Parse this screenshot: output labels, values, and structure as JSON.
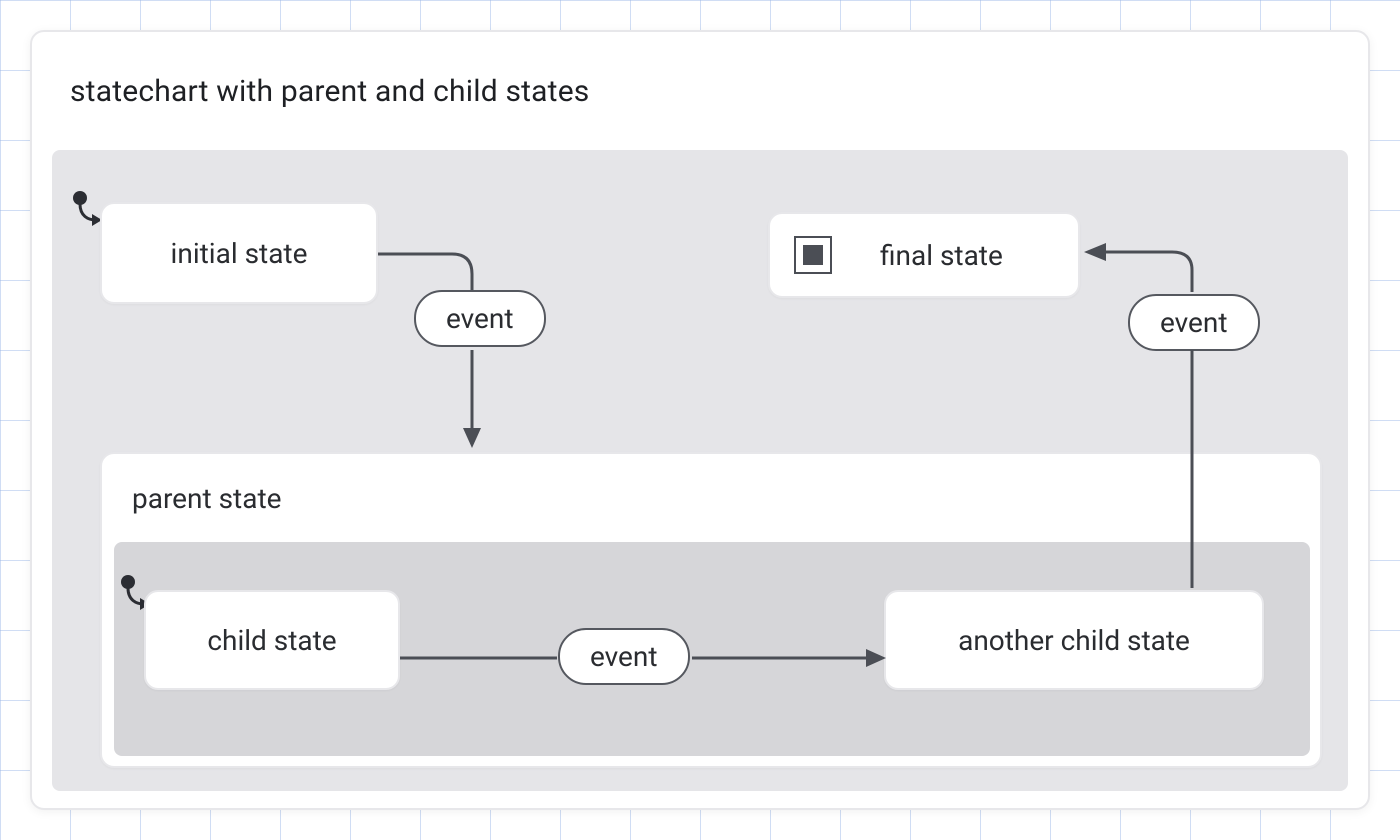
{
  "chart": {
    "title": "statechart with parent and child states",
    "states": {
      "initial": {
        "label": "initial state"
      },
      "final": {
        "label": "final state"
      },
      "parent": {
        "label": "parent state"
      },
      "child1": {
        "label": "child state"
      },
      "child2": {
        "label": "another child state"
      }
    },
    "events": {
      "e1": "event",
      "e2": "event",
      "e3": "event"
    }
  },
  "chart_data": {
    "type": "statechart",
    "title": "statechart with parent and child states",
    "initial": "initial state",
    "states": [
      {
        "id": "initial state",
        "type": "state",
        "initial": true
      },
      {
        "id": "final state",
        "type": "final"
      },
      {
        "id": "parent state",
        "type": "compound",
        "initial": "child state",
        "states": [
          {
            "id": "child state",
            "type": "state",
            "initial": true
          },
          {
            "id": "another child state",
            "type": "state"
          }
        ]
      }
    ],
    "transitions": [
      {
        "from": "initial state",
        "to": "parent state",
        "event": "event"
      },
      {
        "from": "child state",
        "to": "another child state",
        "event": "event"
      },
      {
        "from": "another child state",
        "to": "final state",
        "event": "event"
      }
    ]
  }
}
